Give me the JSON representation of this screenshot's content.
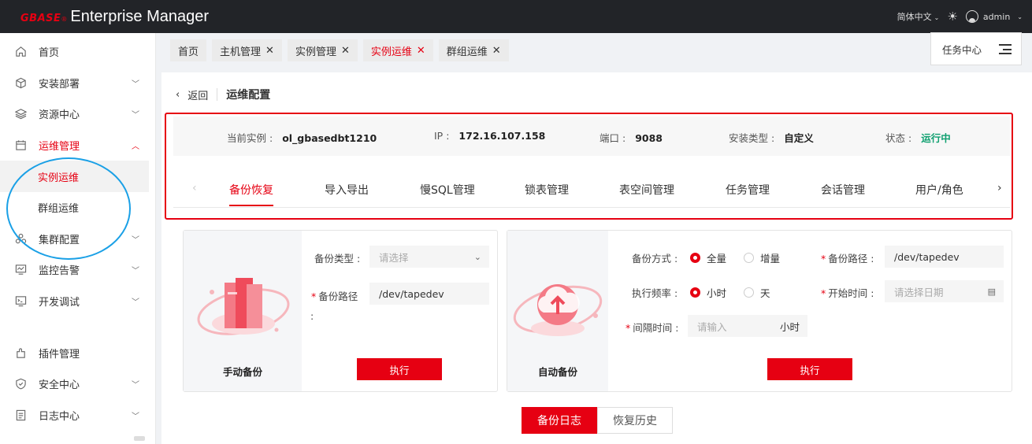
{
  "app": {
    "logo": "GBASE",
    "logo_reg": "®",
    "title": "Enterprise Manager"
  },
  "topbar": {
    "language": "简体中文",
    "user": "admin"
  },
  "sidebar": {
    "items": [
      {
        "label": "首页",
        "icon": "home-icon"
      },
      {
        "label": "安装部署",
        "icon": "box-icon"
      },
      {
        "label": "资源中心",
        "icon": "layers-icon"
      },
      {
        "label": "运维管理",
        "icon": "calendar-icon"
      },
      {
        "label": "集群配置",
        "icon": "cluster-icon"
      },
      {
        "label": "监控告警",
        "icon": "monitor-icon"
      },
      {
        "label": "开发调试",
        "icon": "terminal-icon"
      },
      {
        "label": "插件管理",
        "icon": "plugin-icon"
      },
      {
        "label": "安全中心",
        "icon": "shield-icon"
      },
      {
        "label": "日志中心",
        "icon": "document-icon"
      }
    ],
    "subitems": [
      {
        "label": "实例运维"
      },
      {
        "label": "群组运维"
      }
    ]
  },
  "page_tabs": [
    {
      "label": "首页"
    },
    {
      "label": "主机管理"
    },
    {
      "label": "实例管理"
    },
    {
      "label": "实例运维"
    },
    {
      "label": "群组运维"
    }
  ],
  "task_center": {
    "label": "任务中心"
  },
  "header": {
    "back": "返回",
    "title": "运维配置"
  },
  "instance": {
    "current_label": "当前实例 :",
    "current_value": "ol_gbasedbt1210",
    "ip_label": "IP :",
    "ip_value": "172.16.107.158",
    "port_label": "端口 :",
    "port_value": "9088",
    "install_label": "安装类型 :",
    "install_value": "自定义",
    "status_label": "状态 :",
    "status_value": "运行中"
  },
  "sub_tabs": [
    "备份恢复",
    "导入导出",
    "慢SQL管理",
    "锁表管理",
    "表空间管理",
    "任务管理",
    "会话管理",
    "用户/角色"
  ],
  "manual_backup": {
    "card_label": "手动备份",
    "type_label": "备份类型 :",
    "type_placeholder": "请选择",
    "path_label": "备份路径",
    "path_colon": ":",
    "path_value": "/dev/tapedev",
    "execute": "执行"
  },
  "auto_backup": {
    "card_label": "自动备份",
    "mode_label": "备份方式 :",
    "mode_full": "全量",
    "mode_incr": "增量",
    "path_label": "备份路径 :",
    "path_value": "/dev/tapedev",
    "freq_label": "执行频率 :",
    "freq_hour": "小时",
    "freq_day": "天",
    "start_label": "开始时间 :",
    "start_placeholder": "请选择日期",
    "interval_label": "间隔时间 :",
    "interval_placeholder": "请输入",
    "interval_unit": "小时",
    "execute": "执行"
  },
  "bottom_tabs": {
    "log": "备份日志",
    "history": "恢复历史"
  },
  "colors": {
    "brand": "#e60012",
    "running": "#10a070",
    "annotation": "#1aa0e6"
  }
}
